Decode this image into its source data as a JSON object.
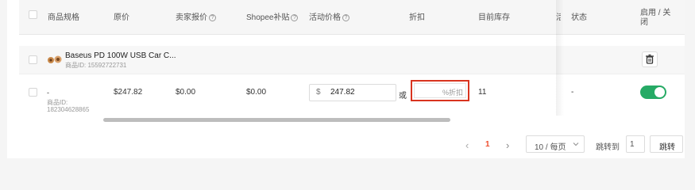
{
  "table": {
    "headers": {
      "spec": "商品规格",
      "original_price": "原价",
      "seller_price": "卖家报价",
      "shopee_subsidy": "Shopee补贴",
      "promo_price": "活动价格",
      "discount": "折扣",
      "stock": "目前库存",
      "cut_col": "活",
      "status": "状态",
      "enable": "启用 / 关\n闭"
    },
    "help_icon": "?",
    "product": {
      "name": "Baseus PD 100W USB Car C...",
      "id_text": "商品ID: 15592722731"
    },
    "variant": {
      "name": "-",
      "id_label": "商品ID:",
      "id_value": "182304628865",
      "original_price": "$247.82",
      "seller_price": "$0.00",
      "shopee_subsidy": "$0.00",
      "currency": "$",
      "promo_price_value": "247.82",
      "or": "或",
      "discount_placeholder": "%折扣",
      "stock": "11",
      "status": "-",
      "enabled": true
    }
  },
  "pagination": {
    "prev": "‹",
    "current": "1",
    "next": "›",
    "page_size": "10 / 每页",
    "goto_label": "跳转到",
    "goto_value": "1",
    "goto_button": "跳转"
  },
  "icons": {
    "trash": "trash-icon",
    "dropdown": "chevron-down-icon"
  },
  "colors": {
    "toggle_on": "#26aa65",
    "accent_red": "#ee4d2d",
    "highlight_border": "#d9341f"
  }
}
